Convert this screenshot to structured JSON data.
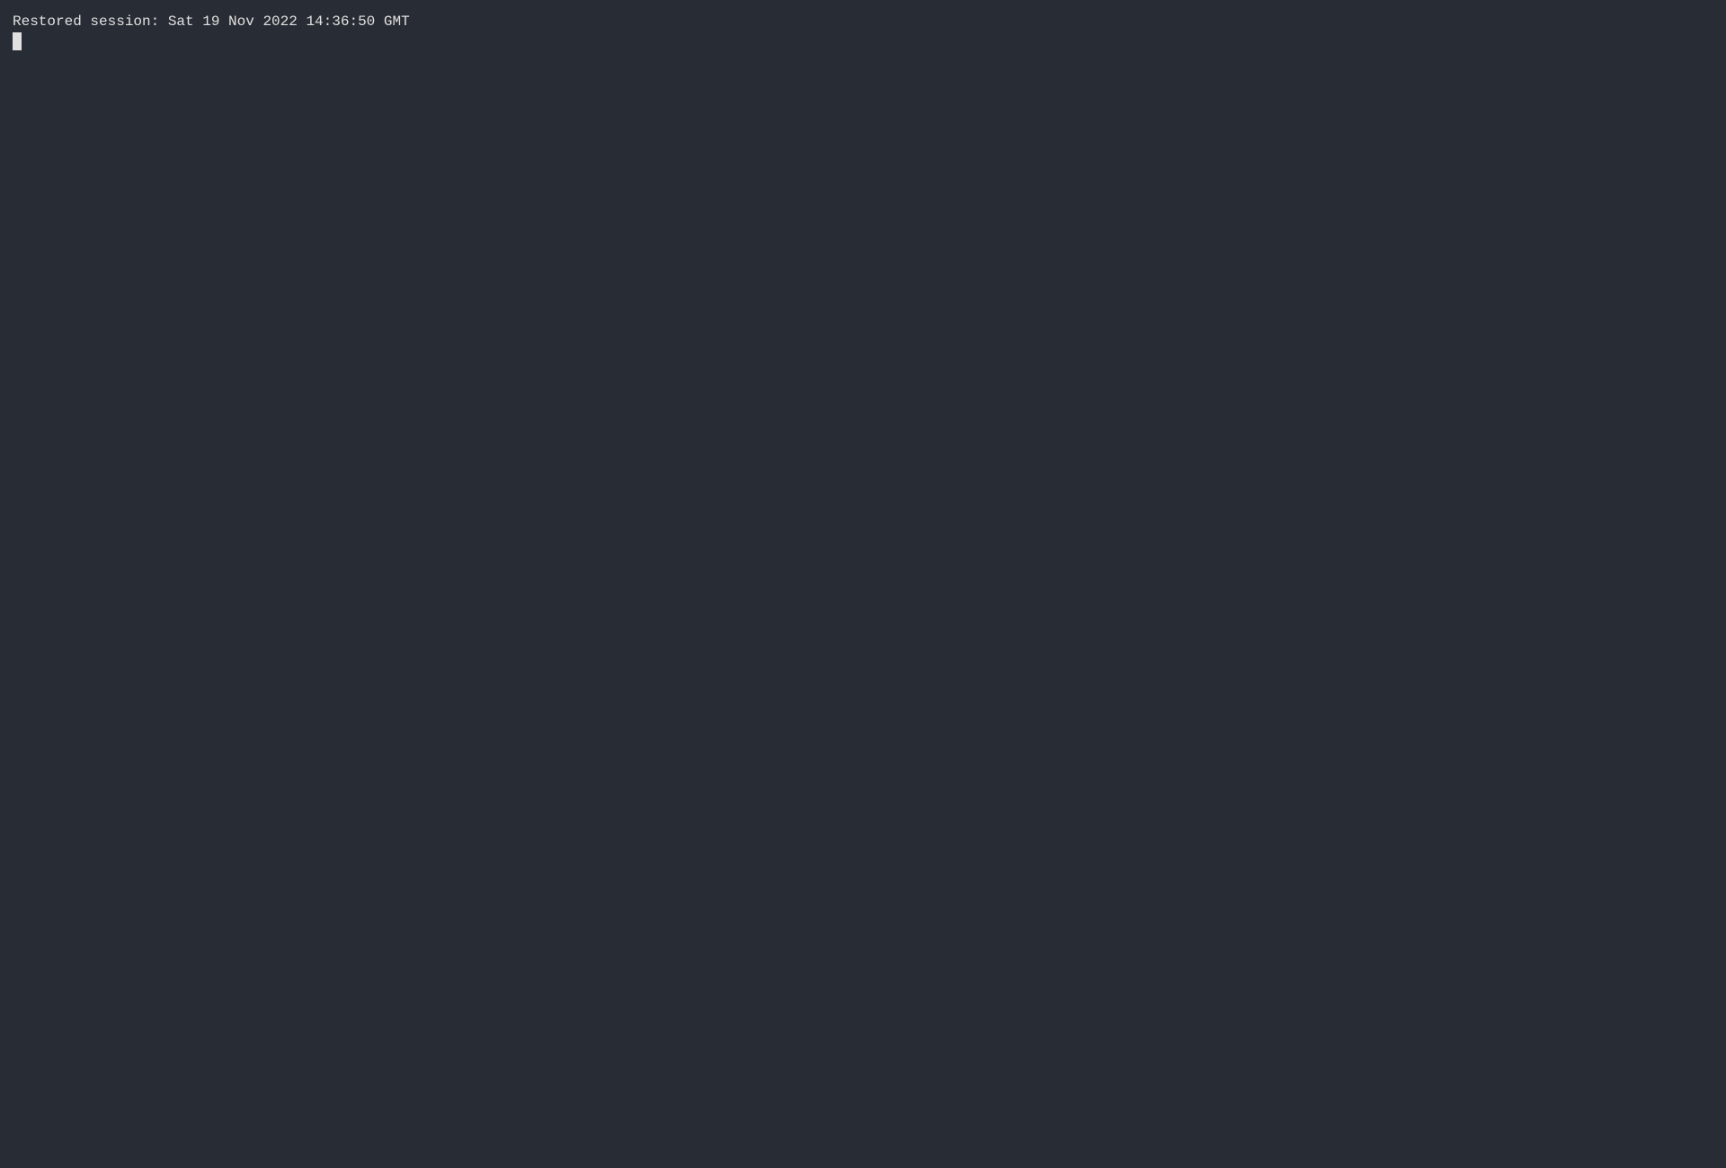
{
  "terminal": {
    "background_color": "#282c34",
    "text_color": "#e0e0e0",
    "font_family": "monospace",
    "session_message": "Restored session: Sat 19 Nov 2022 14:36:50 GMT",
    "cursor_visible": true
  }
}
